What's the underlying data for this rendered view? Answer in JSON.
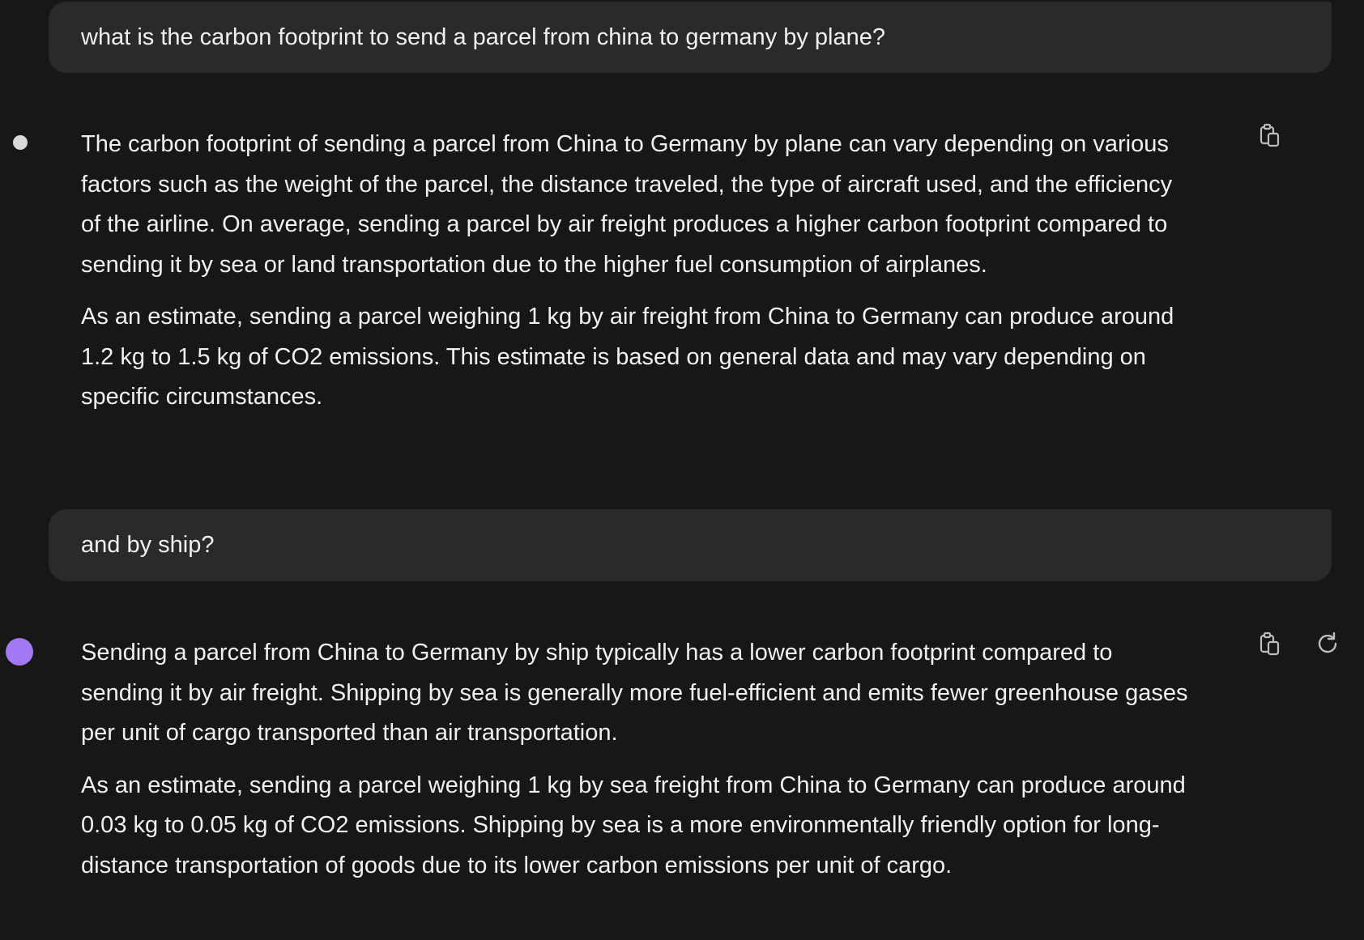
{
  "conversation": {
    "user_messages": [
      {
        "text": "what is the carbon footprint to send a parcel from china to germany by plane?"
      },
      {
        "text": "and by ship?"
      }
    ],
    "assistant_messages": [
      {
        "paragraphs": [
          "The carbon footprint of sending a parcel from China to Germany by plane can vary depending on various factors such as the weight of the parcel, the distance traveled, the type of aircraft used, and the efficiency of the airline. On average, sending a parcel by air freight produces a higher carbon footprint compared to sending it by sea or land transportation due to the higher fuel consumption of airplanes.",
          "As an estimate, sending a parcel weighing 1 kg by air freight from China to Germany can produce around 1.2 kg to 1.5 kg of CO2 emissions. This estimate is based on general data and may vary depending on specific circumstances."
        ]
      },
      {
        "paragraphs": [
          "Sending a parcel from China to Germany by ship typically has a lower carbon footprint compared to sending it by air freight. Shipping by sea is generally more fuel-efficient and emits fewer greenhouse gases per unit of cargo transported than air transportation.",
          "As an estimate, sending a parcel weighing 1 kg by sea freight from China to Germany can produce around 0.03 kg to 0.05 kg of CO2 emissions. Shipping by sea is a more environmentally friendly option for long-distance transportation of goods due to its lower carbon emissions per unit of cargo."
        ]
      }
    ]
  },
  "icons": {
    "copy": "clipboard-copy-icon",
    "regenerate": "refresh-icon"
  },
  "colors": {
    "background": "#171718",
    "user_bubble": "#2a2a2b",
    "text": "#f0f0f0",
    "status_dot_idle": "#d9d9d9",
    "status_dot_active": "#a278f5"
  }
}
